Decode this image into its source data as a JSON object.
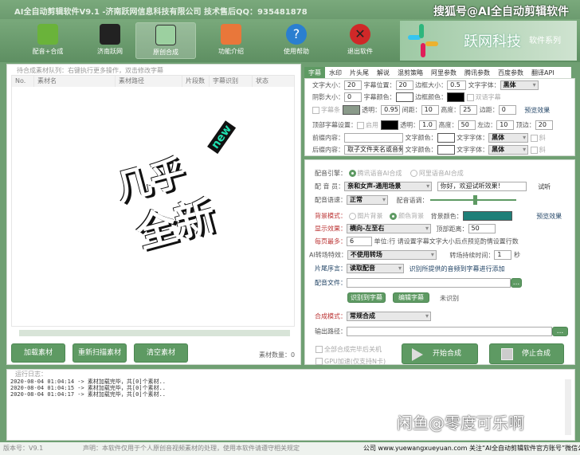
{
  "window": {
    "title": "AI全自动剪辑软件V9.1 -济南跃网信息科技有限公司 技术售后QQ：935481878",
    "watermark_top": "搜狐号@AI全自动剪辑软件",
    "watermark_bottom": "闲鱼@零度可乐啊"
  },
  "toolbar": [
    {
      "label": "配音+合成",
      "icon": "clapperboard-icon"
    },
    {
      "label": "济南跃网",
      "icon": "film-reel-icon"
    },
    {
      "label": "原创合成",
      "icon": "picture-icon",
      "active": true
    },
    {
      "label": "功能介绍",
      "icon": "home-icon"
    },
    {
      "label": "使用帮助",
      "icon": "help-icon"
    },
    {
      "label": "退出软件",
      "icon": "close-icon"
    }
  ],
  "brand": {
    "name": "跃网科技",
    "sub": "软件系列"
  },
  "queue": {
    "legend": "待合成素材队列：右键执行更多操作，双击修改字幕",
    "columns": [
      "No.",
      "素材名",
      "素材路径",
      "片段数",
      "字幕识别",
      "状态"
    ],
    "sticker": {
      "text1": "几乎",
      "text2": "全新",
      "badge": "new"
    },
    "buttons": {
      "load": "加载素材",
      "rescan": "重新扫描素材",
      "clear": "清空素材"
    },
    "count_label": "素材数量：",
    "count": "0"
  },
  "tabs": [
    {
      "label": "字幕",
      "active": true
    },
    {
      "label": "水印"
    },
    {
      "label": "片头尾"
    },
    {
      "label": "解说"
    },
    {
      "label": "混剪策略"
    },
    {
      "label": "阿里参数"
    },
    {
      "label": "腾讯参数"
    },
    {
      "label": "百度参数"
    },
    {
      "label": "翻译API"
    }
  ],
  "subtitle": {
    "font_size_label": "文字大小：",
    "font_size": "20",
    "position_label": "字幕位置：",
    "position": "20",
    "border_size_label": "边框大小：",
    "border_size": "0.5",
    "font_label": "文字字体：",
    "font": "黑体",
    "shadow_label": "阴影大小：",
    "shadow": "0",
    "sub_color_label": "字幕颜色：",
    "border_color_label": "边框颜色：",
    "bilingual": "双语字幕",
    "bar_label": "字幕条",
    "alpha_label": "透明：",
    "alpha": "0.95",
    "spacing_label": "间距：",
    "spacing": "10",
    "height_label": "高度：",
    "height": "25",
    "margin_label": "边距：",
    "margin": "0",
    "preview": "预览效果",
    "top_label": "顶部字幕设置：",
    "top_enable": "启用",
    "top_alpha_label": "透明：",
    "top_alpha": "1.0",
    "top_height_label": "高度：",
    "top_height": "50",
    "left_label": "左边：",
    "left": "10",
    "top_edge_label": "顶边：",
    "top_edge": "20",
    "prefix_label": "前缀内容：",
    "prefix": "",
    "suffix_label": "后缀内容：",
    "suffix": "取子文件夹名或音频",
    "text_color_label": "文字颜色：",
    "text_font_label": "文字字体：",
    "text_font": "黑体",
    "italic": "斜"
  },
  "voice": {
    "engine_label": "配音引擎：",
    "engine_tencent": "腾讯语音AI合成",
    "engine_ali": "阿里语音AI合成",
    "speaker_label": "配 音 员：",
    "speaker": "亲和女声-通用场景",
    "test_text": "你好，欢迎试听效果！",
    "listen": "试听",
    "speed_label": "配音语速：",
    "speed": "正常",
    "pitch_label": "配音语调：",
    "pitch_value": 0.5,
    "bg_mode_label": "背景模式：",
    "bg_image": "图片背景",
    "bg_color_opt": "颜色背景",
    "bg_color_label": "背景颜色：",
    "bg_color": "#1f7f78",
    "preview": "预览效果",
    "effect_label": "显示效果：",
    "effect": "横向-左至右",
    "top_dist_label": "顶部距离：",
    "top_dist": "50",
    "lines_label": "每页最多：",
    "lines": "6",
    "lines_hint": "单位:行 请设置字幕文字大小后点预览酌情设置行数",
    "transition_label": "AI转场特效：",
    "transition": "不使用转场",
    "trans_time_label": "转场持续时间：",
    "trans_time": "1",
    "trans_unit": "秒",
    "tail_label": "片尾序言：",
    "tail": "读取配音",
    "tail_hint": "识别所提供的音频到字幕进行添加",
    "audio_file_label": "配音文件：",
    "audio_file": "",
    "browse": "...",
    "recognize": "识别到字幕",
    "edit": "编辑字幕",
    "recognize_status": "未识别",
    "mode_label": "合成模式：",
    "mode": "常规合成",
    "output_label": "输出路径：",
    "output": "",
    "shutdown": "全部合成完毕后关机",
    "gpu": "GPU加速(仅支持N卡)",
    "start": "开始合成",
    "stop": "停止合成"
  },
  "log": {
    "legend": "运行日志：",
    "lines": [
      "2020-08-04 01:04:14 -> 素材加载完毕，共[0]个素材..",
      "2020-08-04 01:04:15 -> 素材加载完毕，共[0]个素材..",
      "2020-08-04 01:04:17 -> 素材加载完毕，共[0]个素材.."
    ]
  },
  "status": {
    "version": "版本号：V9.1",
    "notice": "声明：本软件仅用于个人原创音视频素材的处理，使用本软件请遵守相关规定",
    "company": "公司 www.yuewangxueyuan.com 关注“AI全自动剪辑软件官方账号”微信公"
  },
  "colors": {
    "accent": "#5e9a63",
    "label_red": "#b33333"
  }
}
